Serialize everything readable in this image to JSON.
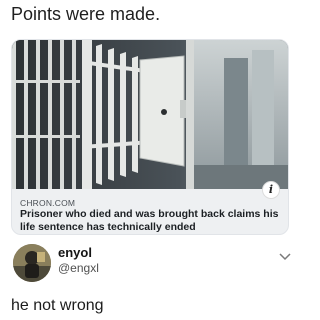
{
  "caption": "Points were made.",
  "link_card": {
    "source": "CHRON.COM",
    "headline": "Prisoner who died and was brought back claims his life sentence has technically ended",
    "info_icon": "info-icon",
    "image_icon": "prison-cell-door-photo"
  },
  "author": {
    "display_name": "enyol",
    "handle": "@engxl",
    "avatar_icon": "avatar",
    "menu_icon": "chevron-down-icon"
  },
  "tweet_text": "he not wrong"
}
